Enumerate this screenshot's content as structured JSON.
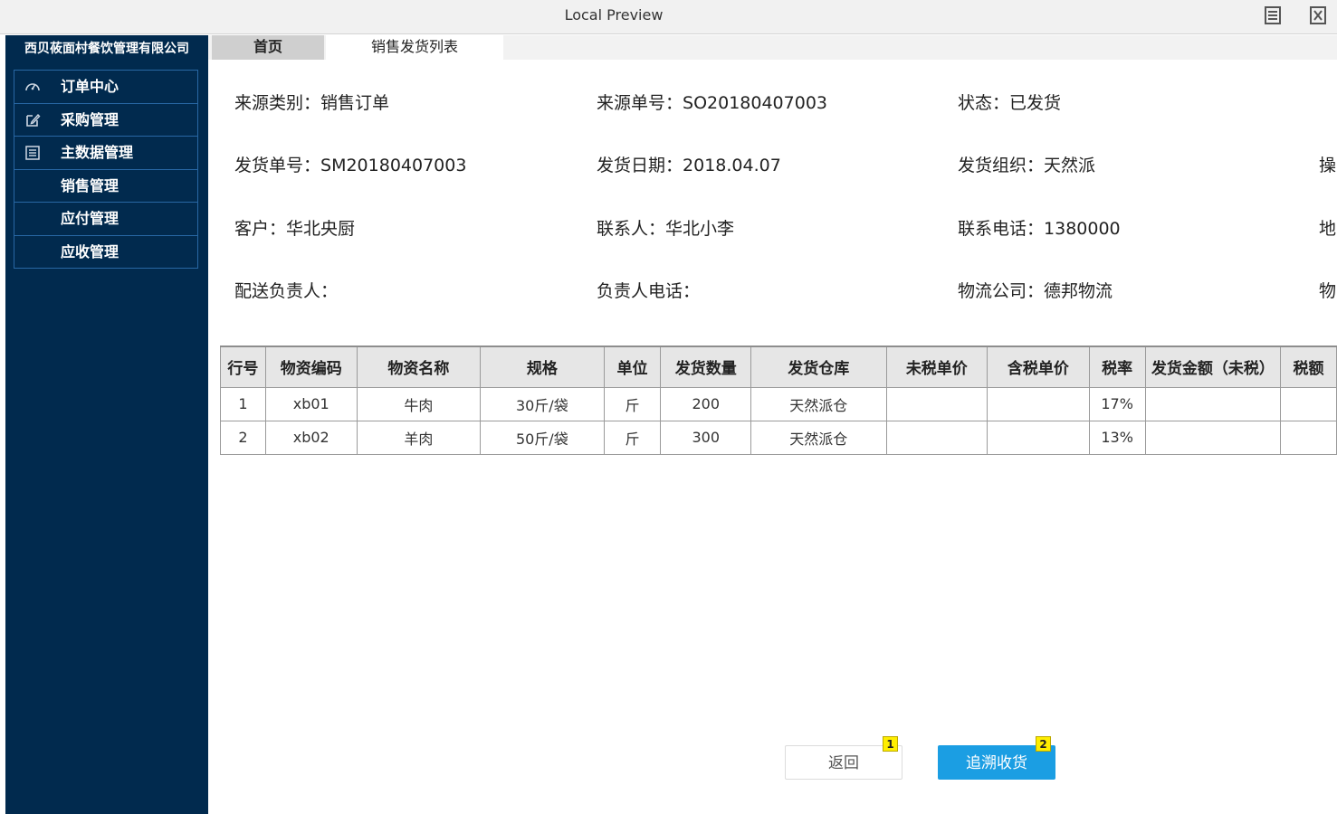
{
  "window": {
    "title": "Local Preview",
    "icons": [
      "notes-icon",
      "close-x-icon"
    ]
  },
  "sidebar": {
    "company": "西贝莜面村餐饮管理有限公司",
    "items": [
      {
        "label": "订单中心",
        "icon": "dashboard-icon"
      },
      {
        "label": "采购管理",
        "icon": "edit-icon"
      },
      {
        "label": "主数据管理",
        "icon": "list-icon"
      },
      {
        "label": "销售管理",
        "icon": ""
      },
      {
        "label": "应付管理",
        "icon": ""
      },
      {
        "label": "应收管理",
        "icon": ""
      }
    ]
  },
  "tabs": {
    "home": "首页",
    "active": "销售发货列表"
  },
  "info": {
    "r1c1": {
      "k": "来源类别：",
      "v": "销售订单"
    },
    "r1c2": {
      "k": "来源单号：",
      "v": "SO20180407003"
    },
    "r1c3": {
      "k": "状态：",
      "v": "已发货"
    },
    "r2c1": {
      "k": "发货单号：",
      "v": "SM20180407003"
    },
    "r2c2": {
      "k": "发货日期：",
      "v": "2018.04.07"
    },
    "r2c3": {
      "k": "发货组织：",
      "v": "天然派"
    },
    "r2c4": {
      "k": "操",
      "v": ""
    },
    "r3c1": {
      "k": "客户：",
      "v": "华北央厨"
    },
    "r3c2": {
      "k": "联系人：",
      "v": "华北小李"
    },
    "r3c3": {
      "k": "联系电话：",
      "v": "1380000"
    },
    "r3c4": {
      "k": "地",
      "v": ""
    },
    "r4c1": {
      "k": "配送负责人：",
      "v": ""
    },
    "r4c2": {
      "k": "负责人电话：",
      "v": ""
    },
    "r4c3": {
      "k": "物流公司：",
      "v": "德邦物流"
    },
    "r4c4": {
      "k": "物",
      "v": ""
    }
  },
  "table": {
    "headers": [
      "行号",
      "物资编码",
      "物资名称",
      "规格",
      "单位",
      "发货数量",
      "发货仓库",
      "未税单价",
      "含税单价",
      "税率",
      "发货金额（未税）",
      "税额"
    ],
    "rows": [
      [
        "1",
        "xb01",
        "牛肉",
        "30斤/袋",
        "斤",
        "200",
        "天然派仓",
        "",
        "",
        "17%",
        "",
        ""
      ],
      [
        "2",
        "xb02",
        "羊肉",
        "50斤/袋",
        "斤",
        "300",
        "天然派仓",
        "",
        "",
        "13%",
        "",
        ""
      ]
    ]
  },
  "buttons": {
    "back": "返回",
    "trace": "追溯收货",
    "badge1": "1",
    "badge2": "2"
  }
}
